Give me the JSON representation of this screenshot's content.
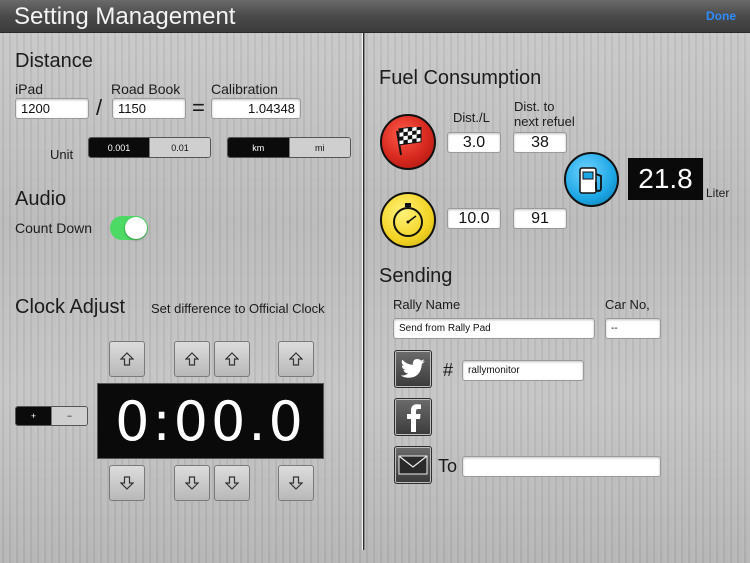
{
  "header": {
    "title": "Setting Management",
    "done_label": "Done"
  },
  "distance": {
    "title": "Distance",
    "ipad_label": "iPad",
    "ipad_value": "1200",
    "roadbook_label": "Road Book",
    "roadbook_value": "1150",
    "calibration_label": "Calibration",
    "calibration_value": "1.04348",
    "slash": "/",
    "equals": "=",
    "unit_label": "Unit",
    "precision_options": [
      "0.001",
      "0.01"
    ],
    "precision_selected": "0.001",
    "unit_options": [
      "km",
      "mi"
    ],
    "unit_selected": "km"
  },
  "audio": {
    "title": "Audio",
    "countdown_label": "Count Down",
    "countdown_on": true
  },
  "clock": {
    "title": "Clock Adjust",
    "subtitle": "Set difference to Official Clock",
    "sign_plus": "+",
    "sign_minus": "−",
    "display": "0:00.0"
  },
  "fuel": {
    "title": "Fuel Consumption",
    "dist_per_l_label": "Dist./L",
    "dist_next_label_line1": "Dist. to",
    "dist_next_label_line2": "next refuel",
    "rally_dist_per_l": "3.0",
    "rally_dist_next": "38",
    "normal_dist_per_l": "10.0",
    "normal_dist_next": "91",
    "liters": "21.8",
    "liter_unit": "Liter"
  },
  "sending": {
    "title": "Sending",
    "rally_name_label": "Rally Name",
    "rally_name_value": "Send from Rally Pad",
    "car_no_label": "Car No,",
    "car_no_value": "--",
    "hash": "#",
    "hashtag_value": "rallymonitor",
    "to_label": "To",
    "to_value": ""
  },
  "colors": {
    "accent": "#2d8cff",
    "toggle_on": "#4cd964",
    "checker_red": "#d6281e",
    "stopwatch_yellow": "#f2d323",
    "fuel_blue": "#1ca6e4"
  }
}
